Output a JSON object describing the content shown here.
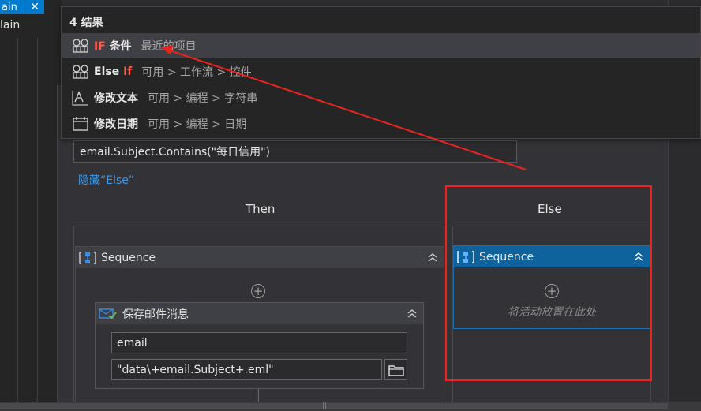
{
  "tab": {
    "title": "ain",
    "close": "✕"
  },
  "left_label": "lain",
  "popup": {
    "count": "4 结果",
    "items": [
      {
        "name_hl": "IF",
        "name_rest": " 条件",
        "desc": "最近的项目",
        "icon": "activity-icon"
      },
      {
        "name_pre": "Else ",
        "name_hl": "If",
        "desc": "可用 > 工作流 > 控件",
        "icon": "activity-icon"
      },
      {
        "name": "修改文本",
        "desc": "可用 > 编程 > 字符串",
        "icon": "text-edit-icon"
      },
      {
        "name": "修改日期",
        "desc": "可用 > 编程 > 日期",
        "icon": "calendar-icon"
      }
    ]
  },
  "condition": "email.Subject.Contains(\"每日信用\")",
  "hide_else": "隐藏“Else”",
  "then": {
    "title": "Then",
    "sequence": "Sequence"
  },
  "else": {
    "title": "Else",
    "sequence": "Sequence",
    "drop_hint": "将活动放置在此处"
  },
  "save_activity": {
    "title": "保存邮件消息",
    "field_mail": "email",
    "field_path": "\"data\\+email.Subject+.eml\""
  },
  "colors": {
    "accent": "#007acc",
    "selected": "#0e639c",
    "annotation": "#e8251f",
    "link": "#3d9ae8"
  }
}
